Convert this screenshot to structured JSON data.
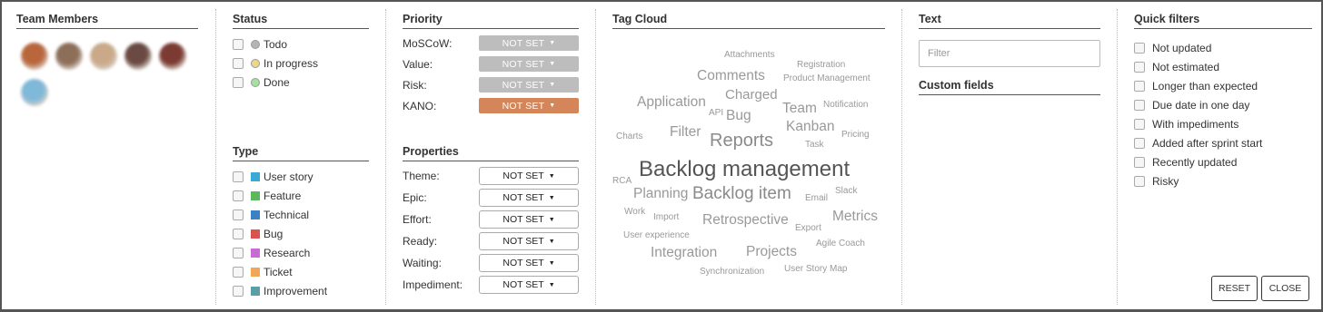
{
  "team_members": {
    "title": "Team Members",
    "avatars": [
      {
        "color": "#b9663c"
      },
      {
        "color": "#8d6e58"
      },
      {
        "color": "#c9a988"
      },
      {
        "color": "#6a4a42"
      },
      {
        "color": "#7b3a32"
      },
      {
        "color": "#7fb8d8"
      }
    ]
  },
  "status": {
    "title": "Status",
    "items": [
      {
        "label": "Todo",
        "color": "#b5b5b5"
      },
      {
        "label": "In progress",
        "color": "#ecd78e"
      },
      {
        "label": "Done",
        "color": "#a6e29f"
      }
    ]
  },
  "type": {
    "title": "Type",
    "items": [
      {
        "label": "User story",
        "color": "#3aa9d6"
      },
      {
        "label": "Feature",
        "color": "#5cb85c"
      },
      {
        "label": "Technical",
        "color": "#3b82c4"
      },
      {
        "label": "Bug",
        "color": "#d9534f"
      },
      {
        "label": "Research",
        "color": "#c86bd5"
      },
      {
        "label": "Ticket",
        "color": "#f0a858"
      },
      {
        "label": "Improvement",
        "color": "#5a9ea8"
      }
    ]
  },
  "priority": {
    "title": "Priority",
    "items": [
      {
        "label": "MoSCoW:",
        "value": "NOT SET"
      },
      {
        "label": "Value:",
        "value": "NOT SET"
      },
      {
        "label": "Risk:",
        "value": "NOT SET"
      },
      {
        "label": "KANO:",
        "value": "NOT SET"
      }
    ]
  },
  "properties": {
    "title": "Properties",
    "items": [
      {
        "label": "Theme:",
        "value": "NOT SET"
      },
      {
        "label": "Epic:",
        "value": "NOT SET"
      },
      {
        "label": "Effort:",
        "value": "NOT SET"
      },
      {
        "label": "Ready:",
        "value": "NOT SET"
      },
      {
        "label": "Waiting:",
        "value": "NOT SET"
      },
      {
        "label": "Impediment:",
        "value": "NOT SET"
      }
    ]
  },
  "tag_cloud": {
    "title": "Tag Cloud",
    "tags": [
      "Attachments",
      "Registration",
      "Comments",
      "Product Management",
      "Charged",
      "Application",
      "Notification",
      "API",
      "Bug",
      "Team",
      "Kanban",
      "Filter",
      "Pricing",
      "Charts",
      "Reports",
      "Task",
      "Backlog management",
      "RCA",
      "Planning",
      "Backlog item",
      "Slack",
      "Email",
      "Work",
      "Import",
      "Retrospective",
      "Metrics",
      "Export",
      "User experience",
      "Agile Coach",
      "Integration",
      "Projects",
      "Synchronization",
      "User Story Map"
    ]
  },
  "text_filter": {
    "title": "Text",
    "placeholder": "Filter"
  },
  "custom_fields": {
    "title": "Custom fields"
  },
  "quick_filters": {
    "title": "Quick filters",
    "items": [
      "Not updated",
      "Not estimated",
      "Longer than expected",
      "Due date in one day",
      "With impediments",
      "Added after sprint start",
      "Recently updated",
      "Risky"
    ]
  },
  "buttons": {
    "reset": "RESET",
    "close": "CLOSE"
  }
}
